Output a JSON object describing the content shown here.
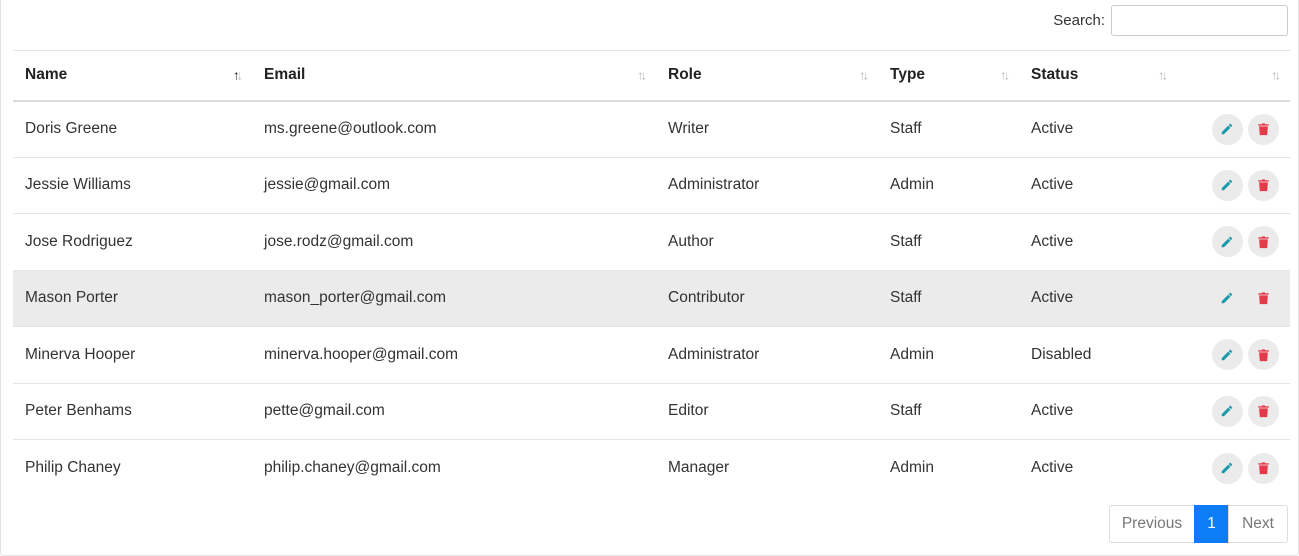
{
  "search": {
    "label": "Search:",
    "value": "",
    "placeholder": ""
  },
  "columns": [
    {
      "label": "Name",
      "sorted": "asc"
    },
    {
      "label": "Email",
      "sorted": "none"
    },
    {
      "label": "Role",
      "sorted": "none"
    },
    {
      "label": "Type",
      "sorted": "none"
    },
    {
      "label": "Status",
      "sorted": "none"
    },
    {
      "label": "",
      "sorted": "none"
    }
  ],
  "rows": [
    {
      "name": "Doris Greene",
      "email": "ms.greene@outlook.com",
      "role": "Writer",
      "type": "Staff",
      "status": "Active"
    },
    {
      "name": "Jessie Williams",
      "email": "jessie@gmail.com",
      "role": "Administrator",
      "type": "Admin",
      "status": "Active"
    },
    {
      "name": "Jose Rodriguez",
      "email": "jose.rodz@gmail.com",
      "role": "Author",
      "type": "Staff",
      "status": "Active"
    },
    {
      "name": "Mason Porter",
      "email": "mason_porter@gmail.com",
      "role": "Contributor",
      "type": "Staff",
      "status": "Active"
    },
    {
      "name": "Minerva Hooper",
      "email": "minerva.hooper@gmail.com",
      "role": "Administrator",
      "type": "Admin",
      "status": "Disabled"
    },
    {
      "name": "Peter Benhams",
      "email": "pette@gmail.com",
      "role": "Editor",
      "type": "Staff",
      "status": "Active"
    },
    {
      "name": "Philip Chaney",
      "email": "philip.chaney@gmail.com",
      "role": "Manager",
      "type": "Admin",
      "status": "Active"
    }
  ],
  "icons": {
    "edit": "pencil-icon",
    "delete": "trash-icon"
  },
  "colors": {
    "edit": "#1a9aa8",
    "delete": "#e8394b",
    "page_active": "#0d7df5"
  },
  "pagination": {
    "previous": "Previous",
    "current": "1",
    "next": "Next"
  }
}
